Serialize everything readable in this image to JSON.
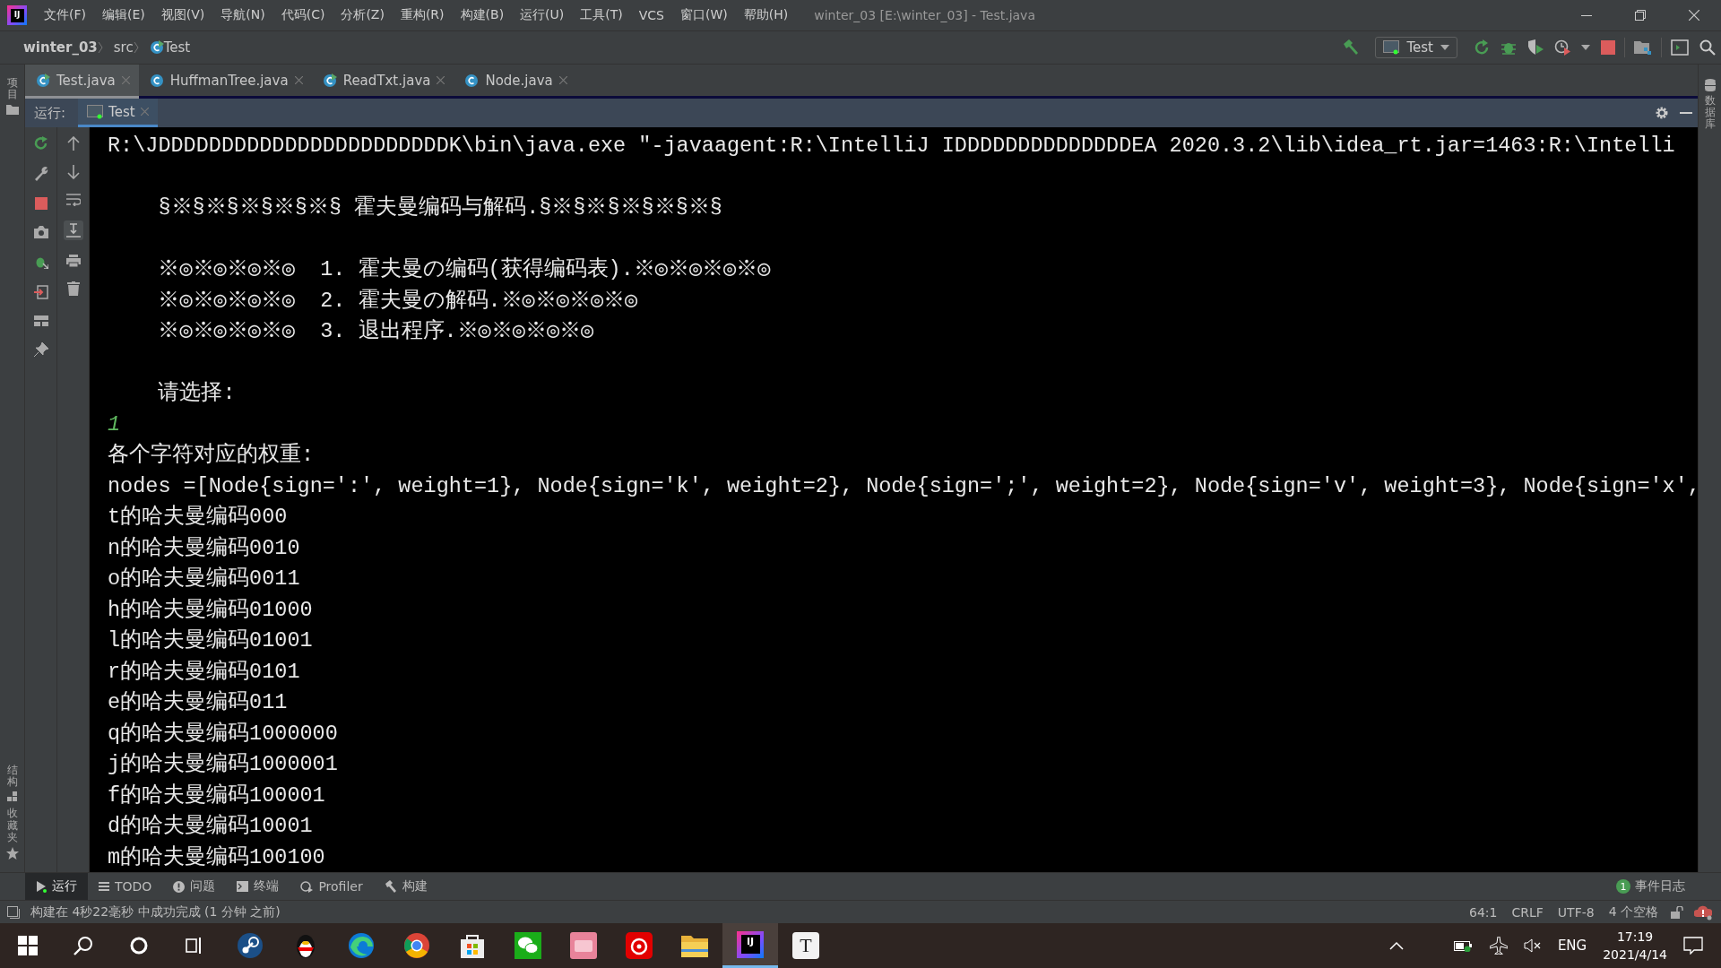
{
  "window": {
    "title": "winter_03 [E:\\winter_03] - Test.java",
    "app_glyph": "IJ"
  },
  "menu": [
    {
      "label": "文件(F)"
    },
    {
      "label": "编辑(E)"
    },
    {
      "label": "视图(V)"
    },
    {
      "label": "导航(N)"
    },
    {
      "label": "代码(C)"
    },
    {
      "label": "分析(Z)"
    },
    {
      "label": "重构(R)"
    },
    {
      "label": "构建(B)"
    },
    {
      "label": "运行(U)"
    },
    {
      "label": "工具(T)"
    },
    {
      "label": "VCS"
    },
    {
      "label": "窗口(W)"
    },
    {
      "label": "帮助(H)"
    }
  ],
  "breadcrumb": [
    {
      "label": "winter_03",
      "kind": "project"
    },
    {
      "label": "src",
      "kind": "folder"
    },
    {
      "label": "Test",
      "kind": "class"
    }
  ],
  "run_config": {
    "label": "Test"
  },
  "editor_tabs": [
    {
      "label": "Test.java",
      "kind": "runnable",
      "selected": true
    },
    {
      "label": "HuffmanTree.java",
      "kind": "class",
      "selected": false
    },
    {
      "label": "ReadTxt.java",
      "kind": "runnable",
      "selected": false
    },
    {
      "label": "Node.java",
      "kind": "class",
      "selected": false
    }
  ],
  "left_strip": {
    "top": [
      {
        "label": "项目",
        "kind": "project"
      }
    ],
    "bottom": [
      {
        "label": "结构",
        "kind": "structure"
      },
      {
        "label": "收藏夹",
        "kind": "favorites"
      }
    ]
  },
  "right_strip": [
    {
      "label": "数据库",
      "kind": "database"
    }
  ],
  "run_panel": {
    "label": "运行:",
    "tabs": [
      {
        "label": "Test",
        "selected": true
      }
    ],
    "console": [
      {
        "kind": "text",
        "text": "R:\\JDDDDDDDDDDDDDDDDDDDDDDDK\\bin\\java.exe \"-javaagent:R:\\IntelliJ IDDDDDDDDDDDDDDEA 2020.3.2\\lib\\idea_rt.jar=1463:R:\\Intelli"
      },
      {
        "kind": "blank"
      },
      {
        "kind": "text",
        "text": "    §※§※§※§※§※§ 霍夫曼编码与解码.§※§※§※§※§※§"
      },
      {
        "kind": "blank"
      },
      {
        "kind": "text",
        "text": "    ※◎※◎※◎※◎  1. 霍夫曼の编码(获得编码表).※◎※◎※◎※◎"
      },
      {
        "kind": "text",
        "text": "    ※◎※◎※◎※◎  2. 霍夫曼の解码.※◎※◎※◎※◎"
      },
      {
        "kind": "text",
        "text": "    ※◎※◎※◎※◎  3. 退出程序.※◎※◎※◎※◎"
      },
      {
        "kind": "blank"
      },
      {
        "kind": "text",
        "text": "    请选择:"
      },
      {
        "kind": "input",
        "text": "1"
      },
      {
        "kind": "text",
        "text": "各个字符对应的权重:"
      },
      {
        "kind": "text",
        "text": "nodes =[Node{sign=':', weight=1}, Node{sign='k', weight=2}, Node{sign=';', weight=2}, Node{sign='v', weight=3}, Node{sign='x',"
      },
      {
        "kind": "text",
        "text": "t的哈夫曼编码000"
      },
      {
        "kind": "text",
        "text": "n的哈夫曼编码0010"
      },
      {
        "kind": "text",
        "text": "o的哈夫曼编码0011"
      },
      {
        "kind": "text",
        "text": "h的哈夫曼编码01000"
      },
      {
        "kind": "text",
        "text": "l的哈夫曼编码01001"
      },
      {
        "kind": "text",
        "text": "r的哈夫曼编码0101"
      },
      {
        "kind": "text",
        "text": "e的哈夫曼编码011"
      },
      {
        "kind": "text",
        "text": "q的哈夫曼编码1000000"
      },
      {
        "kind": "text",
        "text": "j的哈夫曼编码1000001"
      },
      {
        "kind": "text",
        "text": "f的哈夫曼编码100001"
      },
      {
        "kind": "text",
        "text": "d的哈夫曼编码10001"
      },
      {
        "kind": "text",
        "text": "m的哈夫曼编码100100"
      }
    ]
  },
  "tool_tabs": [
    {
      "label": "运行",
      "kind": "run",
      "selected": true
    },
    {
      "label": "TODO",
      "kind": "todo",
      "selected": false
    },
    {
      "label": "问题",
      "kind": "problems",
      "selected": false
    },
    {
      "label": "终端",
      "kind": "terminal",
      "selected": false
    },
    {
      "label": "Profiler",
      "kind": "profiler",
      "selected": false
    },
    {
      "label": "构建",
      "kind": "build",
      "selected": false
    }
  ],
  "event_log": {
    "count": "1",
    "label": "事件日志"
  },
  "status_bar": {
    "message": "构建在 4秒22毫秒 中成功完成 (1 分钟 之前)",
    "items": [
      "64:1",
      "CRLF",
      "UTF-8",
      "4 个空格"
    ]
  },
  "taskbar": {
    "apps": [
      {
        "kind": "start",
        "selected": false
      },
      {
        "kind": "search",
        "selected": false
      },
      {
        "kind": "cortana",
        "selected": false
      },
      {
        "kind": "taskview",
        "selected": false
      },
      {
        "kind": "steam",
        "selected": false
      },
      {
        "kind": "penguin",
        "selected": false
      },
      {
        "kind": "edge",
        "selected": false
      },
      {
        "kind": "chrome",
        "selected": false
      },
      {
        "kind": "store",
        "selected": false
      },
      {
        "kind": "wechat",
        "selected": false
      },
      {
        "kind": "pinkapp",
        "selected": false
      },
      {
        "kind": "music",
        "selected": false
      },
      {
        "kind": "explorer",
        "selected": false
      },
      {
        "kind": "idea",
        "glyph": "IJ",
        "selected": true
      },
      {
        "kind": "typora",
        "glyph": "T",
        "selected": false
      }
    ],
    "tray": {
      "language": "ENG",
      "time": "17:19",
      "date": "2021/4/14"
    }
  }
}
